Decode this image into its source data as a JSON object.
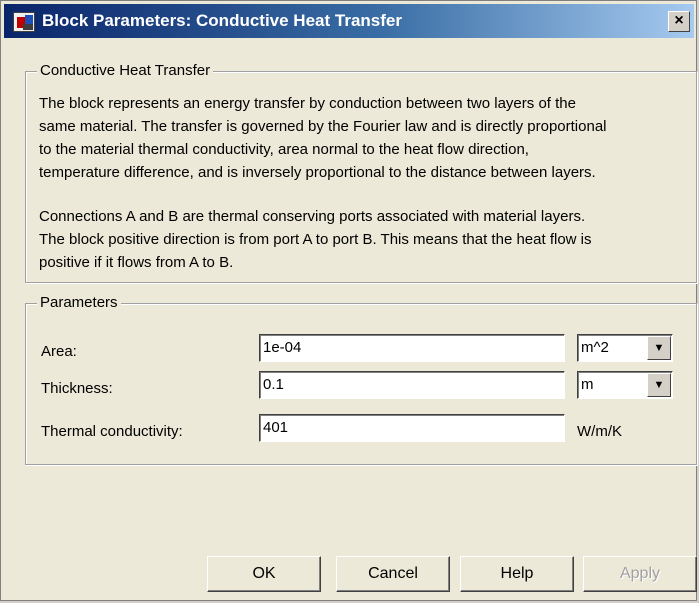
{
  "window": {
    "title": "Block Parameters: Conductive Heat Transfer",
    "close_glyph": "×"
  },
  "description_group": {
    "legend": "Conductive Heat Transfer",
    "lines": [
      "The block represents an energy transfer by conduction between two layers of the",
      "same material. The transfer is governed by the Fourier law and is directly proportional",
      "to the material thermal conductivity, area normal to the heat flow direction,",
      "temperature difference, and is inversely proportional to the distance between layers.",
      "",
      "Connections A and B are thermal conserving ports associated with material layers.",
      "The block positive direction is from port A to port B. This means that the heat flow is",
      "positive if it flows from A to B."
    ]
  },
  "parameters_group": {
    "legend": "Parameters",
    "area": {
      "label": "Area:",
      "value": "1e-04",
      "unit": "m^2"
    },
    "thickness": {
      "label": "Thickness:",
      "value": "0.1",
      "unit": "m"
    },
    "conductivity": {
      "label": "Thermal conductivity:",
      "value": "401",
      "unit": "W/m/K"
    }
  },
  "buttons": {
    "ok": "OK",
    "cancel": "Cancel",
    "help": "Help",
    "apply": "Apply"
  },
  "icons": {
    "dropdown": "▼"
  }
}
